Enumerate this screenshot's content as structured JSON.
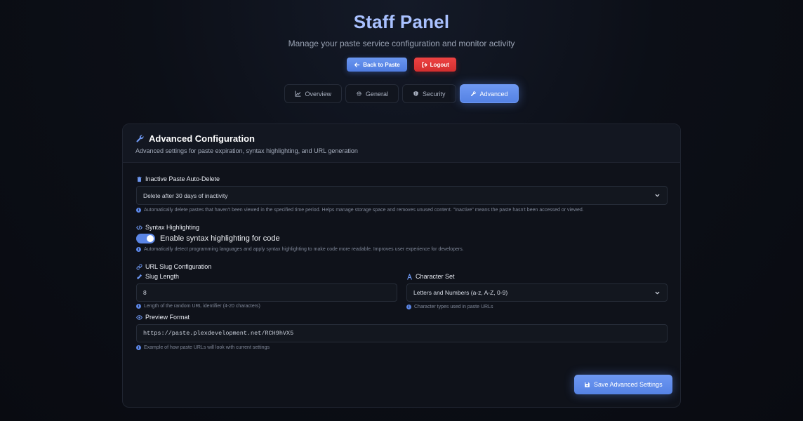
{
  "header": {
    "title": "Staff Panel",
    "subtitle": "Manage your paste service configuration and monitor activity"
  },
  "actions": {
    "back_label": "Back to Paste",
    "logout_label": "Logout"
  },
  "tabs": [
    {
      "label": "Overview",
      "icon": "chart-icon",
      "active": false
    },
    {
      "label": "General",
      "icon": "gear-icon",
      "active": false
    },
    {
      "label": "Security",
      "icon": "shield-icon",
      "active": false
    },
    {
      "label": "Advanced",
      "icon": "wrench-icon",
      "active": true
    }
  ],
  "card": {
    "title": "Advanced Configuration",
    "description": "Advanced settings for paste expiration, syntax highlighting, and URL generation"
  },
  "auto_delete": {
    "label": "Inactive Paste Auto-Delete",
    "value": "Delete after 30 days of inactivity",
    "help": "Automatically delete pastes that haven't been viewed in the specified time period. Helps manage storage space and removes unused content. \"Inactive\" means the paste hasn't been accessed or viewed."
  },
  "syntax": {
    "label": "Syntax Highlighting",
    "toggle_label": "Enable syntax highlighting for code",
    "enabled": true,
    "help": "Automatically detect programming languages and apply syntax highlighting to make code more readable. Improves user experience for developers."
  },
  "slug": {
    "section_label": "URL Slug Configuration",
    "length_label": "Slug Length",
    "length_value": "8",
    "length_help": "Length of the random URL identifier (4-20 characters)",
    "charset_label": "Character Set",
    "charset_value": "Letters and Numbers (a-z, A-Z, 0-9)",
    "charset_help": "Character types used in paste URLs",
    "preview_label": "Preview Format",
    "preview_value": "https://paste.plexdevelopment.net/RCH9hVX5",
    "preview_help": "Example of how paste URLs will look with current settings"
  },
  "save_label": "Save Advanced Settings",
  "colors": {
    "accent": "#5b86e6",
    "danger": "#d42e2e",
    "title": "#a9c1ff"
  }
}
